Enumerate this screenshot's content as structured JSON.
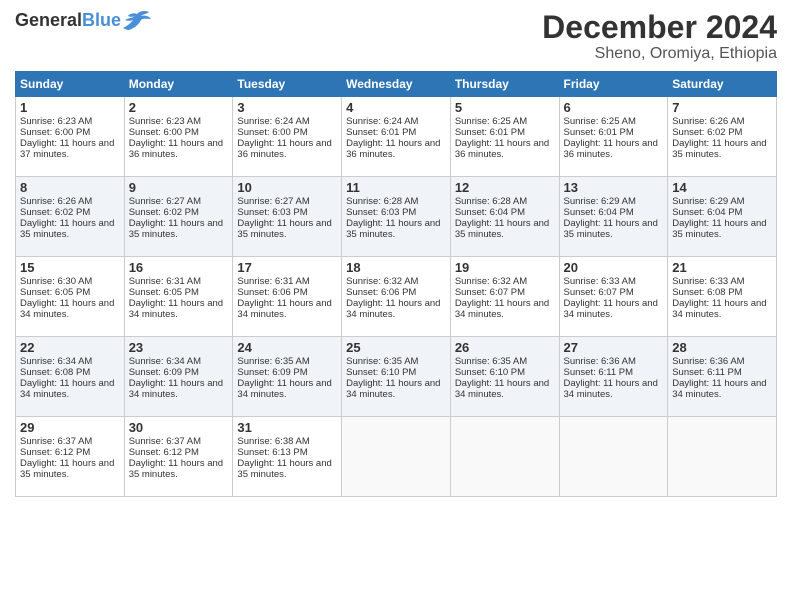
{
  "header": {
    "logo_general": "General",
    "logo_blue": "Blue",
    "title": "December 2024",
    "location": "Sheno, Oromiya, Ethiopia"
  },
  "days_of_week": [
    "Sunday",
    "Monday",
    "Tuesday",
    "Wednesday",
    "Thursday",
    "Friday",
    "Saturday"
  ],
  "weeks": [
    [
      {
        "day": 1,
        "sunrise": "6:23 AM",
        "sunset": "6:00 PM",
        "daylight": "11 hours and 37 minutes."
      },
      {
        "day": 2,
        "sunrise": "6:23 AM",
        "sunset": "6:00 PM",
        "daylight": "11 hours and 36 minutes."
      },
      {
        "day": 3,
        "sunrise": "6:24 AM",
        "sunset": "6:00 PM",
        "daylight": "11 hours and 36 minutes."
      },
      {
        "day": 4,
        "sunrise": "6:24 AM",
        "sunset": "6:01 PM",
        "daylight": "11 hours and 36 minutes."
      },
      {
        "day": 5,
        "sunrise": "6:25 AM",
        "sunset": "6:01 PM",
        "daylight": "11 hours and 36 minutes."
      },
      {
        "day": 6,
        "sunrise": "6:25 AM",
        "sunset": "6:01 PM",
        "daylight": "11 hours and 36 minutes."
      },
      {
        "day": 7,
        "sunrise": "6:26 AM",
        "sunset": "6:02 PM",
        "daylight": "11 hours and 35 minutes."
      }
    ],
    [
      {
        "day": 8,
        "sunrise": "6:26 AM",
        "sunset": "6:02 PM",
        "daylight": "11 hours and 35 minutes."
      },
      {
        "day": 9,
        "sunrise": "6:27 AM",
        "sunset": "6:02 PM",
        "daylight": "11 hours and 35 minutes."
      },
      {
        "day": 10,
        "sunrise": "6:27 AM",
        "sunset": "6:03 PM",
        "daylight": "11 hours and 35 minutes."
      },
      {
        "day": 11,
        "sunrise": "6:28 AM",
        "sunset": "6:03 PM",
        "daylight": "11 hours and 35 minutes."
      },
      {
        "day": 12,
        "sunrise": "6:28 AM",
        "sunset": "6:04 PM",
        "daylight": "11 hours and 35 minutes."
      },
      {
        "day": 13,
        "sunrise": "6:29 AM",
        "sunset": "6:04 PM",
        "daylight": "11 hours and 35 minutes."
      },
      {
        "day": 14,
        "sunrise": "6:29 AM",
        "sunset": "6:04 PM",
        "daylight": "11 hours and 35 minutes."
      }
    ],
    [
      {
        "day": 15,
        "sunrise": "6:30 AM",
        "sunset": "6:05 PM",
        "daylight": "11 hours and 34 minutes."
      },
      {
        "day": 16,
        "sunrise": "6:31 AM",
        "sunset": "6:05 PM",
        "daylight": "11 hours and 34 minutes."
      },
      {
        "day": 17,
        "sunrise": "6:31 AM",
        "sunset": "6:06 PM",
        "daylight": "11 hours and 34 minutes."
      },
      {
        "day": 18,
        "sunrise": "6:32 AM",
        "sunset": "6:06 PM",
        "daylight": "11 hours and 34 minutes."
      },
      {
        "day": 19,
        "sunrise": "6:32 AM",
        "sunset": "6:07 PM",
        "daylight": "11 hours and 34 minutes."
      },
      {
        "day": 20,
        "sunrise": "6:33 AM",
        "sunset": "6:07 PM",
        "daylight": "11 hours and 34 minutes."
      },
      {
        "day": 21,
        "sunrise": "6:33 AM",
        "sunset": "6:08 PM",
        "daylight": "11 hours and 34 minutes."
      }
    ],
    [
      {
        "day": 22,
        "sunrise": "6:34 AM",
        "sunset": "6:08 PM",
        "daylight": "11 hours and 34 minutes."
      },
      {
        "day": 23,
        "sunrise": "6:34 AM",
        "sunset": "6:09 PM",
        "daylight": "11 hours and 34 minutes."
      },
      {
        "day": 24,
        "sunrise": "6:35 AM",
        "sunset": "6:09 PM",
        "daylight": "11 hours and 34 minutes."
      },
      {
        "day": 25,
        "sunrise": "6:35 AM",
        "sunset": "6:10 PM",
        "daylight": "11 hours and 34 minutes."
      },
      {
        "day": 26,
        "sunrise": "6:35 AM",
        "sunset": "6:10 PM",
        "daylight": "11 hours and 34 minutes."
      },
      {
        "day": 27,
        "sunrise": "6:36 AM",
        "sunset": "6:11 PM",
        "daylight": "11 hours and 34 minutes."
      },
      {
        "day": 28,
        "sunrise": "6:36 AM",
        "sunset": "6:11 PM",
        "daylight": "11 hours and 34 minutes."
      }
    ],
    [
      {
        "day": 29,
        "sunrise": "6:37 AM",
        "sunset": "6:12 PM",
        "daylight": "11 hours and 35 minutes."
      },
      {
        "day": 30,
        "sunrise": "6:37 AM",
        "sunset": "6:12 PM",
        "daylight": "11 hours and 35 minutes."
      },
      {
        "day": 31,
        "sunrise": "6:38 AM",
        "sunset": "6:13 PM",
        "daylight": "11 hours and 35 minutes."
      },
      null,
      null,
      null,
      null
    ]
  ]
}
